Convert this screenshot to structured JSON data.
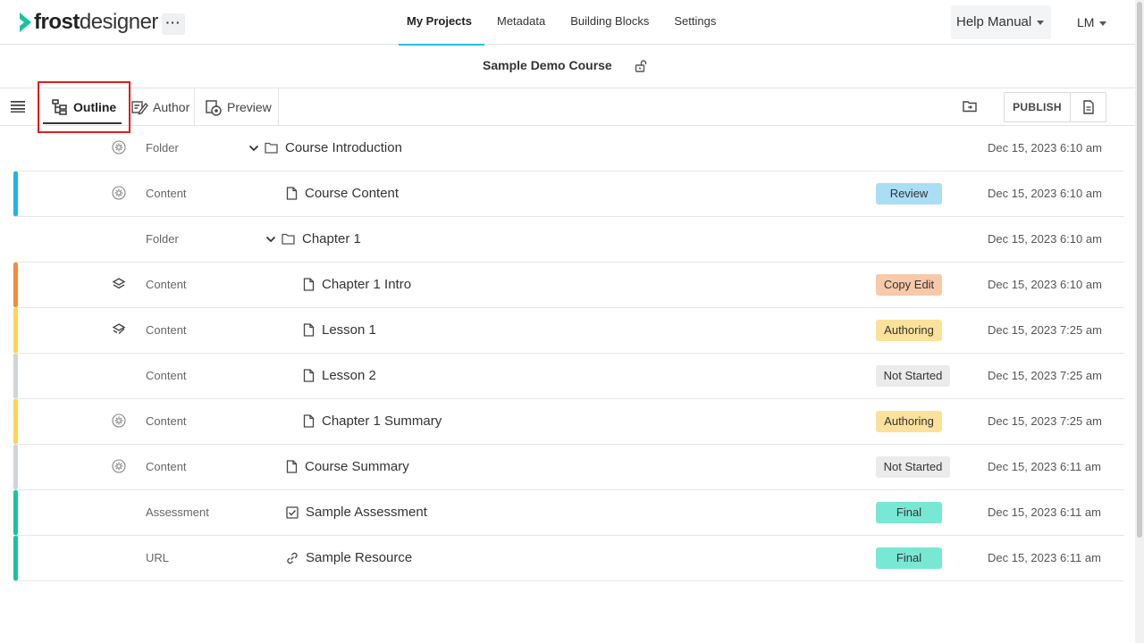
{
  "app": {
    "logo_bold": "frost",
    "logo_light": "designer",
    "more_label": "···"
  },
  "nav": {
    "items": [
      {
        "label": "My Projects",
        "active": true
      },
      {
        "label": "Metadata",
        "active": false
      },
      {
        "label": "Building Blocks",
        "active": false
      },
      {
        "label": "Settings",
        "active": false
      }
    ],
    "help_label": "Help Manual",
    "user_initials": "LM"
  },
  "course": {
    "title": "Sample Demo Course"
  },
  "toolbar": {
    "tabs": [
      {
        "label": "Outline",
        "active": true
      },
      {
        "label": "Author",
        "active": false
      },
      {
        "label": "Preview",
        "active": false
      }
    ],
    "publish_label": "PUBLISH"
  },
  "colors": {
    "accent": "#2bbde0",
    "highlight": "#e01d1d",
    "bar_blue": "#1fb4e8",
    "bar_orange": "#f68b3c",
    "bar_yellow": "#fbd54e",
    "bar_gray": "#cfd5d8",
    "bar_teal": "#17c59d"
  },
  "rows": [
    {
      "type": "Folder",
      "name": "Course Introduction",
      "icon": "folder-icon",
      "indent": 0,
      "expandable": true,
      "status": "",
      "date": "Dec 15, 2023 6:10 am",
      "state_icon": "settings-circle-icon",
      "bar": ""
    },
    {
      "type": "Content",
      "name": "Course Content",
      "icon": "file-icon",
      "indent": 1,
      "expandable": false,
      "status": "Review",
      "date": "Dec 15, 2023 6:10 am",
      "state_icon": "settings-circle-icon",
      "bar": "blue"
    },
    {
      "type": "Folder",
      "name": "Chapter 1",
      "icon": "folder-icon",
      "indent": 1,
      "expandable": true,
      "status": "",
      "date": "Dec 15, 2023 6:10 am",
      "state_icon": "",
      "bar": ""
    },
    {
      "type": "Content",
      "name": "Chapter 1 Intro",
      "icon": "file-icon",
      "indent": 2,
      "expandable": false,
      "status": "Copy Edit",
      "date": "Dec 15, 2023 6:10 am",
      "state_icon": "layers-icon",
      "bar": "orange"
    },
    {
      "type": "Content",
      "name": "Lesson 1",
      "icon": "file-icon",
      "indent": 2,
      "expandable": false,
      "status": "Authoring",
      "date": "Dec 15, 2023 7:25 am",
      "state_icon": "layers-check-icon",
      "bar": "yellow"
    },
    {
      "type": "Content",
      "name": "Lesson 2",
      "icon": "file-icon",
      "indent": 2,
      "expandable": false,
      "status": "Not Started",
      "date": "Dec 15, 2023 7:25 am",
      "state_icon": "",
      "bar": "gray"
    },
    {
      "type": "Content",
      "name": "Chapter 1 Summary",
      "icon": "file-icon",
      "indent": 2,
      "expandable": false,
      "status": "Authoring",
      "date": "Dec 15, 2023 7:25 am",
      "state_icon": "settings-circle-icon",
      "bar": "yellow"
    },
    {
      "type": "Content",
      "name": "Course Summary",
      "icon": "file-icon",
      "indent": 1,
      "expandable": false,
      "status": "Not Started",
      "date": "Dec 15, 2023 6:11 am",
      "state_icon": "settings-circle-icon",
      "bar": "gray"
    },
    {
      "type": "Assessment",
      "name": "Sample Assessment",
      "icon": "checkbox-icon",
      "indent": 1,
      "expandable": false,
      "status": "Final",
      "date": "Dec 15, 2023 6:11 am",
      "state_icon": "",
      "bar": "teal"
    },
    {
      "type": "URL",
      "name": "Sample Resource",
      "icon": "link-icon",
      "indent": 1,
      "expandable": false,
      "status": "Final",
      "date": "Dec 15, 2023 6:11 am",
      "state_icon": "",
      "bar": "teal"
    }
  ]
}
